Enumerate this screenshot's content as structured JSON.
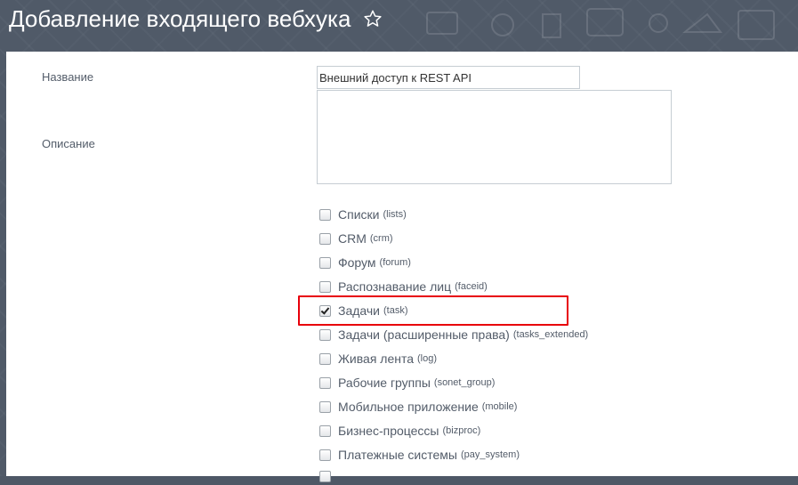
{
  "page": {
    "title": "Добавление входящего вебхука"
  },
  "form": {
    "name_label": "Название",
    "name_value": "Внешний доступ к REST API",
    "description_label": "Описание",
    "description_value": ""
  },
  "permissions": [
    {
      "label": "Списки",
      "code": "(lists)",
      "checked": false
    },
    {
      "label": "CRM",
      "code": "(crm)",
      "checked": false
    },
    {
      "label": "Форум",
      "code": "(forum)",
      "checked": false
    },
    {
      "label": "Распознавание лиц",
      "code": "(faceid)",
      "checked": false
    },
    {
      "label": "Задачи",
      "code": "(task)",
      "checked": true
    },
    {
      "label": "Задачи (расширенные права)",
      "code": "(tasks_extended)",
      "checked": false
    },
    {
      "label": "Живая лента",
      "code": "(log)",
      "checked": false
    },
    {
      "label": "Рабочие группы",
      "code": "(sonet_group)",
      "checked": false
    },
    {
      "label": "Мобильное приложение",
      "code": "(mobile)",
      "checked": false
    },
    {
      "label": "Бизнес-процессы",
      "code": "(bizproc)",
      "checked": false
    },
    {
      "label": "Платежные системы",
      "code": "(pay_system)",
      "checked": false
    }
  ],
  "colors": {
    "header_bg": "#505a68",
    "text": "#535c69",
    "highlight": "#e8000b"
  }
}
